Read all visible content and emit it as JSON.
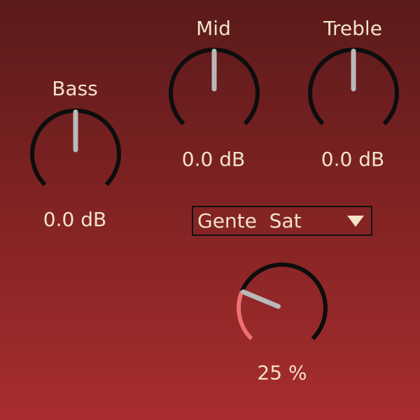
{
  "colors": {
    "background_top": "#5a1a1b",
    "background_bottom": "#a82d2e",
    "text": "#f2e3c9",
    "knob_track": "#0d0d0d",
    "knob_pointer": "#b9b9b9",
    "knob_active_arc": "#f07070"
  },
  "knobs": {
    "bass": {
      "label": "Bass",
      "value": "0.0 dB",
      "position": 0.5
    },
    "mid": {
      "label": "Mid",
      "value": "0.0 dB",
      "position": 0.5
    },
    "treble": {
      "label": "Treble",
      "value": "0.0 dB",
      "position": 0.5
    },
    "drive": {
      "label": "",
      "value": "25 %",
      "position": 0.25
    }
  },
  "mode_select": {
    "selected": "Gente  Sat",
    "icon": "triangle-down-icon"
  }
}
